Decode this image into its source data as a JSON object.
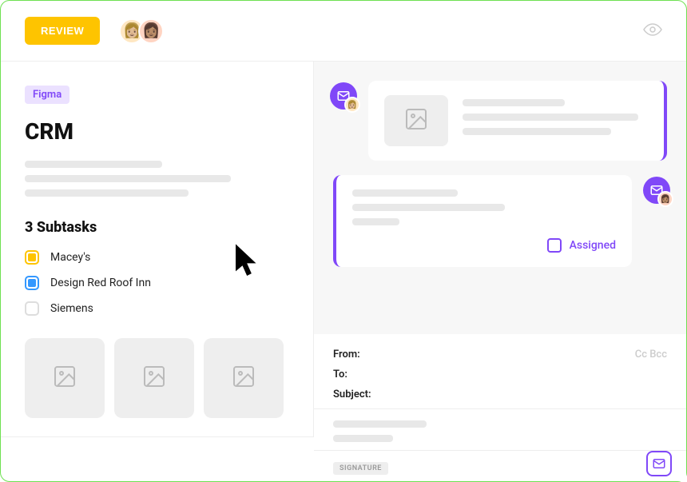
{
  "header": {
    "review_label": "REVIEW"
  },
  "left": {
    "tag": "Figma",
    "title": "CRM",
    "subtasks_title": "3 Subtasks",
    "subtasks": [
      {
        "label": "Macey's",
        "color": "yellow"
      },
      {
        "label": "Design Red Roof Inn",
        "color": "blue"
      },
      {
        "label": "Siemens",
        "color": "none"
      }
    ]
  },
  "right": {
    "assigned_label": "Assigned"
  },
  "compose": {
    "from_label": "From:",
    "to_label": "To:",
    "subject_label": "Subject:",
    "cc_label": "Cc",
    "bcc_label": "Bcc",
    "signature_label": "SIGNATURE"
  },
  "colors": {
    "accent": "#8048f8",
    "warning": "#fec400",
    "blue": "#3498ff"
  }
}
